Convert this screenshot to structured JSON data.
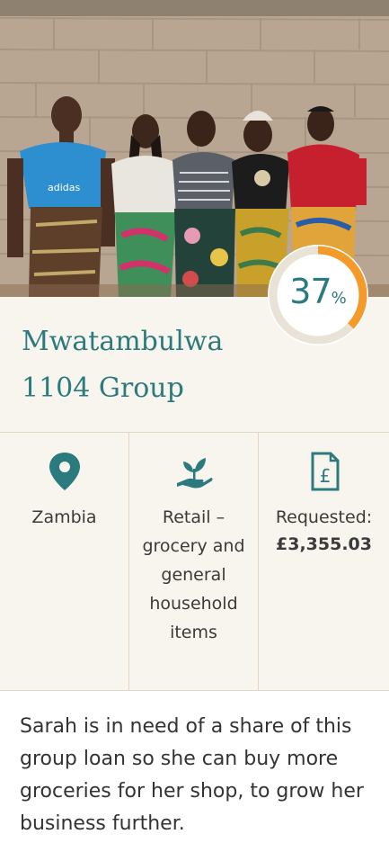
{
  "loan": {
    "name_line1": "Mwatambulwa",
    "name_line2": "1104 Group",
    "funded_percent": 37,
    "funded_percent_label": "37",
    "percent_symbol": "%"
  },
  "facts": {
    "location": {
      "icon": "map-pin-icon",
      "text": "Zambia"
    },
    "sector": {
      "icon": "hand-plant-icon",
      "text": "Retail – grocery and general household items"
    },
    "requested": {
      "icon": "pound-document-icon",
      "label": "Requested:",
      "value": "£3,355.03"
    }
  },
  "description": "Sarah is in need of a share of this group loan so she can buy more groceries for her shop, to grow her business further.",
  "colors": {
    "accent": "#2b7a7e",
    "progress": "#f39a2a",
    "track": "#e8e3d6",
    "panel": "#f8f5ee"
  }
}
